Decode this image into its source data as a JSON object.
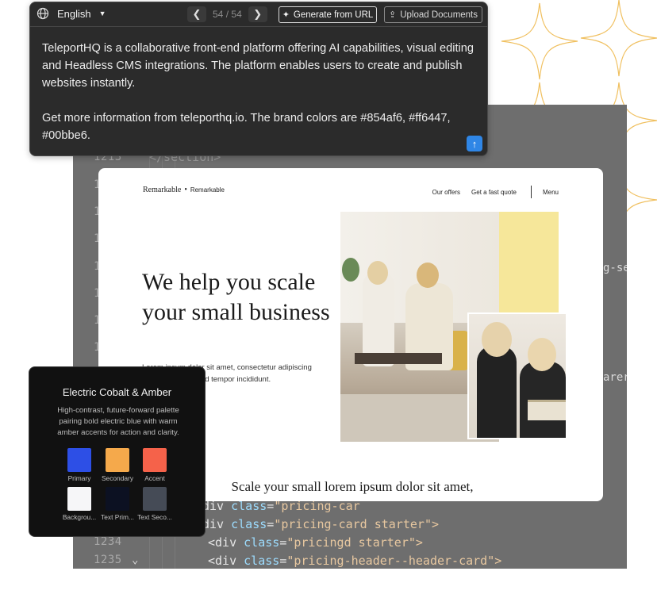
{
  "prompt_panel": {
    "language": "English",
    "pager": {
      "current": "54",
      "separator": "/",
      "total": "54"
    },
    "generate_label": "Generate from URL",
    "upload_label": "Upload Documents",
    "text_paragraph_1": "TeleportHQ is a collaborative front-end platform offering AI capabilities, visual editing and Headless CMS integrations. The platform enables users to create and publish websites instantly.",
    "text_paragraph_2": "Get more information from teleporthq.io. The brand colors are #854af6, #ff6447, #00bbe6."
  },
  "editor": {
    "visible_line_number_top": "1213",
    "closing_tag": "</section>",
    "line_1234": "1234",
    "line_1235": "1235",
    "right_fragment_1": "g-se",
    "right_fragment_2": "arer",
    "code_lines": [
      {
        "prefix": "div ",
        "attr": "class",
        "value": "\"pricing-car"
      },
      {
        "prefix": "div ",
        "attr": "class",
        "value": "\"pricing-card starter\">"
      },
      {
        "prefix": "<div ",
        "attr": "class",
        "value": "\"pricingd starter\">"
      },
      {
        "prefix": "<div ",
        "attr": "class",
        "value": "\"pricing-header--header-card\">"
      }
    ]
  },
  "site_preview": {
    "brand": "Remarkable",
    "brand_sub": "Remarkable",
    "nav": [
      "Our offers",
      "Get a fast quote",
      "Menu"
    ],
    "hero_title": "We help you scale your small business",
    "hero_sub": "Lorem ipsum dolor sit amet, consectetur adipiscing elit, sed do eiusmod tempor incididunt.",
    "bottom_heading": "Scale your small lorem ipsum dolor sit amet,"
  },
  "palette": {
    "title": "Electric Cobalt & Amber",
    "description": "High-contrast, future-forward palette pairing bold electric blue with warm amber accents for action and clarity.",
    "swatches": [
      {
        "label": "Primary",
        "color": "#2d4fe6"
      },
      {
        "label": "Secondary",
        "color": "#f5a94b"
      },
      {
        "label": "Accent",
        "color": "#f5624a"
      },
      {
        "label": "Backgrou...",
        "color": "#f6f6f8"
      },
      {
        "label": "Text Prim...",
        "color": "#0c1122"
      },
      {
        "label": "Text Seco...",
        "color": "#454b56"
      }
    ]
  },
  "colors": {
    "sparkle_outline": "#f0c060",
    "send_button": "#2f86e6",
    "hero_yellow": "#f6e79a"
  }
}
